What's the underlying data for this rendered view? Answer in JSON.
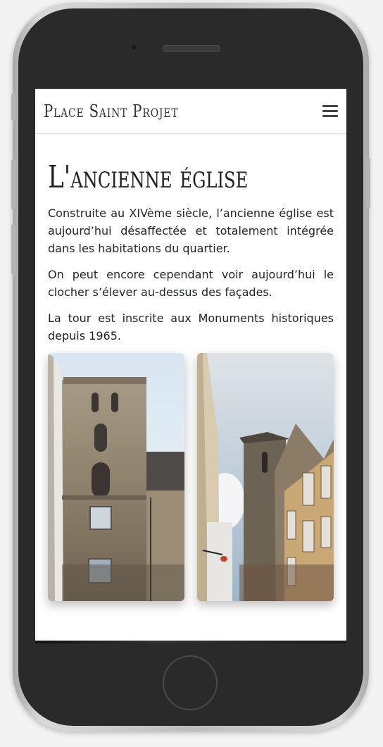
{
  "navbar": {
    "brand": "Place Saint Projet",
    "menu_icon": "hamburger-menu-icon"
  },
  "article": {
    "title": "L'ancienne église",
    "paragraphs": [
      "Construite au XIVème siècle, l’ancienne église est aujourd’hui désaffectée et totalement intégrée dans les habitations du quartier.",
      "On peut encore cependant voir aujourd’hui le clocher s’élever au-dessus des façades.",
      "La tour est inscrite aux Monuments historiques depuis 1965."
    ]
  },
  "photos": [
    {
      "subject": "church-tower-facade"
    },
    {
      "subject": "church-tower-between-buildings"
    }
  ],
  "colors": {
    "text": "#212529",
    "title": "#222222",
    "phone_body": "#2a2a2a"
  }
}
